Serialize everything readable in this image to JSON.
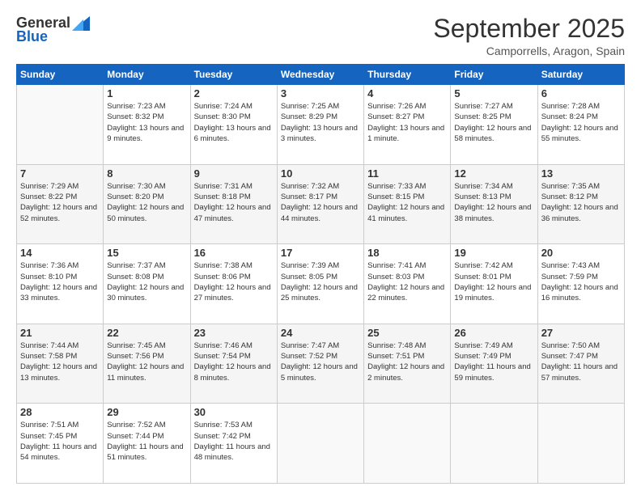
{
  "logo": {
    "text_general": "General",
    "text_blue": "Blue"
  },
  "header": {
    "month": "September 2025",
    "location": "Camporrells, Aragon, Spain"
  },
  "weekdays": [
    "Sunday",
    "Monday",
    "Tuesday",
    "Wednesday",
    "Thursday",
    "Friday",
    "Saturday"
  ],
  "weeks": [
    [
      null,
      {
        "day": "1",
        "sunrise": "7:23 AM",
        "sunset": "8:32 PM",
        "daylight": "13 hours and 9 minutes."
      },
      {
        "day": "2",
        "sunrise": "7:24 AM",
        "sunset": "8:30 PM",
        "daylight": "13 hours and 6 minutes."
      },
      {
        "day": "3",
        "sunrise": "7:25 AM",
        "sunset": "8:29 PM",
        "daylight": "13 hours and 3 minutes."
      },
      {
        "day": "4",
        "sunrise": "7:26 AM",
        "sunset": "8:27 PM",
        "daylight": "13 hours and 1 minute."
      },
      {
        "day": "5",
        "sunrise": "7:27 AM",
        "sunset": "8:25 PM",
        "daylight": "12 hours and 58 minutes."
      },
      {
        "day": "6",
        "sunrise": "7:28 AM",
        "sunset": "8:24 PM",
        "daylight": "12 hours and 55 minutes."
      }
    ],
    [
      {
        "day": "7",
        "sunrise": "7:29 AM",
        "sunset": "8:22 PM",
        "daylight": "12 hours and 52 minutes."
      },
      {
        "day": "8",
        "sunrise": "7:30 AM",
        "sunset": "8:20 PM",
        "daylight": "12 hours and 50 minutes."
      },
      {
        "day": "9",
        "sunrise": "7:31 AM",
        "sunset": "8:18 PM",
        "daylight": "12 hours and 47 minutes."
      },
      {
        "day": "10",
        "sunrise": "7:32 AM",
        "sunset": "8:17 PM",
        "daylight": "12 hours and 44 minutes."
      },
      {
        "day": "11",
        "sunrise": "7:33 AM",
        "sunset": "8:15 PM",
        "daylight": "12 hours and 41 minutes."
      },
      {
        "day": "12",
        "sunrise": "7:34 AM",
        "sunset": "8:13 PM",
        "daylight": "12 hours and 38 minutes."
      },
      {
        "day": "13",
        "sunrise": "7:35 AM",
        "sunset": "8:12 PM",
        "daylight": "12 hours and 36 minutes."
      }
    ],
    [
      {
        "day": "14",
        "sunrise": "7:36 AM",
        "sunset": "8:10 PM",
        "daylight": "12 hours and 33 minutes."
      },
      {
        "day": "15",
        "sunrise": "7:37 AM",
        "sunset": "8:08 PM",
        "daylight": "12 hours and 30 minutes."
      },
      {
        "day": "16",
        "sunrise": "7:38 AM",
        "sunset": "8:06 PM",
        "daylight": "12 hours and 27 minutes."
      },
      {
        "day": "17",
        "sunrise": "7:39 AM",
        "sunset": "8:05 PM",
        "daylight": "12 hours and 25 minutes."
      },
      {
        "day": "18",
        "sunrise": "7:41 AM",
        "sunset": "8:03 PM",
        "daylight": "12 hours and 22 minutes."
      },
      {
        "day": "19",
        "sunrise": "7:42 AM",
        "sunset": "8:01 PM",
        "daylight": "12 hours and 19 minutes."
      },
      {
        "day": "20",
        "sunrise": "7:43 AM",
        "sunset": "7:59 PM",
        "daylight": "12 hours and 16 minutes."
      }
    ],
    [
      {
        "day": "21",
        "sunrise": "7:44 AM",
        "sunset": "7:58 PM",
        "daylight": "12 hours and 13 minutes."
      },
      {
        "day": "22",
        "sunrise": "7:45 AM",
        "sunset": "7:56 PM",
        "daylight": "12 hours and 11 minutes."
      },
      {
        "day": "23",
        "sunrise": "7:46 AM",
        "sunset": "7:54 PM",
        "daylight": "12 hours and 8 minutes."
      },
      {
        "day": "24",
        "sunrise": "7:47 AM",
        "sunset": "7:52 PM",
        "daylight": "12 hours and 5 minutes."
      },
      {
        "day": "25",
        "sunrise": "7:48 AM",
        "sunset": "7:51 PM",
        "daylight": "12 hours and 2 minutes."
      },
      {
        "day": "26",
        "sunrise": "7:49 AM",
        "sunset": "7:49 PM",
        "daylight": "11 hours and 59 minutes."
      },
      {
        "day": "27",
        "sunrise": "7:50 AM",
        "sunset": "7:47 PM",
        "daylight": "11 hours and 57 minutes."
      }
    ],
    [
      {
        "day": "28",
        "sunrise": "7:51 AM",
        "sunset": "7:45 PM",
        "daylight": "11 hours and 54 minutes."
      },
      {
        "day": "29",
        "sunrise": "7:52 AM",
        "sunset": "7:44 PM",
        "daylight": "11 hours and 51 minutes."
      },
      {
        "day": "30",
        "sunrise": "7:53 AM",
        "sunset": "7:42 PM",
        "daylight": "11 hours and 48 minutes."
      },
      null,
      null,
      null,
      null
    ]
  ]
}
